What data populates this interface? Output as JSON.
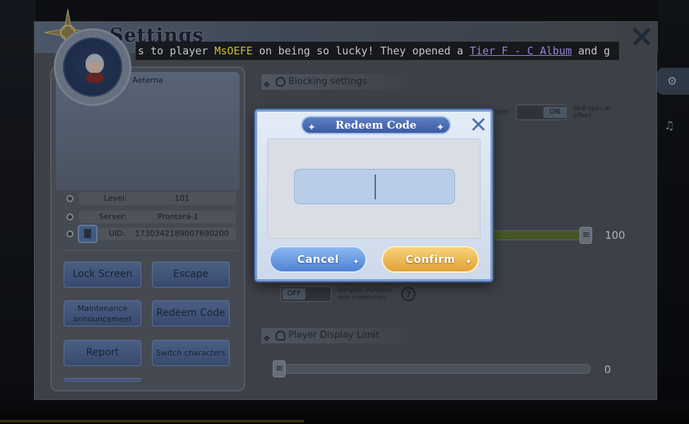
{
  "settings": {
    "title": "Settings"
  },
  "ticker": {
    "lead": "s to player ",
    "player_name": "MsOEFE",
    "mid": " on being so lucky! They opened a ",
    "item_name": "Tier F - C Album",
    "tail": " and g"
  },
  "profile": {
    "character_name": "Aeterna",
    "level_label": "Level:",
    "level_value": "101",
    "server_label": "Server:",
    "server_value": "Prontera-1",
    "uid_label": "UID:",
    "uid_value": "1730342189007690200"
  },
  "profile_buttons": {
    "lock_screen": "Lock Screen",
    "escape": "Escape",
    "maintenance": "Maintenance announcement",
    "redeem_code": "Redeem Code",
    "report": "Report",
    "switch_characters": "Switch characters"
  },
  "right_panel": {
    "blocking_settings": "Blocking settings",
    "model_label": "odel",
    "skill_effect_label": "Skill special effect",
    "dungeon_label": "Dungeon invitation auto preparation",
    "player_display_limit": "Player Display Limit",
    "toggle_on": "ON",
    "toggle_off": "OFF",
    "slider_one_value": "100",
    "slider_one_fraction": 1.0,
    "slider_two_value": "0",
    "slider_two_fraction": 0.0
  },
  "redeem_dialog": {
    "title": "Redeem Code",
    "input_value": "",
    "cancel_label": "Cancel",
    "confirm_label": "Confirm"
  },
  "colors": {
    "player_name": "#f3e23a",
    "item_link": "#b9a2ff",
    "cancel_button": "#5f95df",
    "confirm_button": "#eeb64f"
  }
}
